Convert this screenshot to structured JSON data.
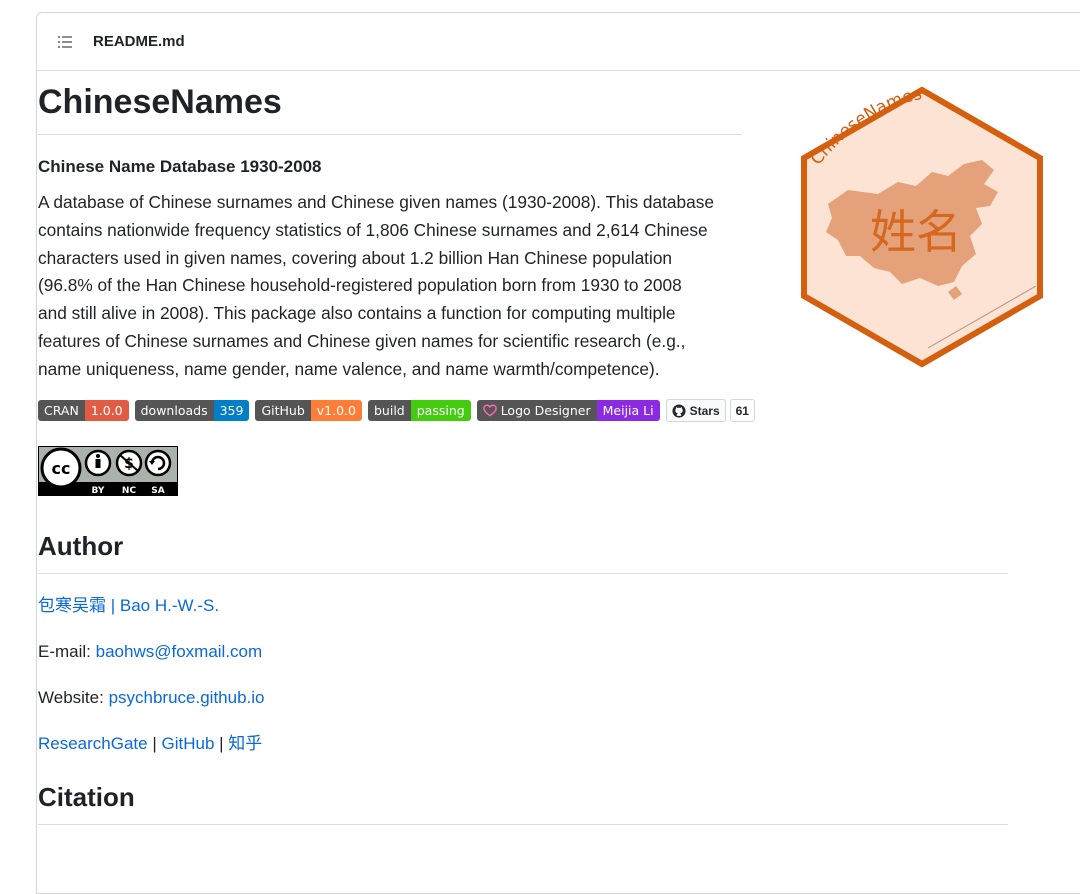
{
  "header": {
    "filename": "README.md",
    "icon": "list-unordered-icon"
  },
  "title": "ChineseNames",
  "subtitle": "Chinese Name Database 1930-2008",
  "description": [
    "A database of Chinese surnames and Chinese given names (1930-2008). This database",
    "contains nationwide frequency statistics of 1,806 Chinese surnames and 2,614 Chinese",
    "characters used in given names, covering about 1.2 billion Han Chinese population",
    "(96.8% of the Han Chinese household-registered population born from 1930 to 2008",
    "and still alive in 2008). This package also contains a function for computing multiple",
    "features of Chinese surnames and Chinese given names for scientific research (e.g.,",
    "name uniqueness, name gender, name valence, and name warmth/competence)."
  ],
  "badges": [
    {
      "left": "CRAN",
      "right": "1.0.0",
      "color": "#e05d44"
    },
    {
      "left": "downloads",
      "right": "359",
      "color": "#007ec6"
    },
    {
      "left": "GitHub",
      "right": "v1.0.0",
      "color": "#fe7d37"
    },
    {
      "left": "build",
      "right": "passing",
      "color": "#4c1"
    },
    {
      "left": "Logo Designer",
      "right": "Meijia Li",
      "color": "#8a2be2",
      "icon": "heart-icon"
    }
  ],
  "github_stars": {
    "label": "Stars",
    "count": "61"
  },
  "license_badge": {
    "labels": [
      "BY",
      "NC",
      "SA"
    ]
  },
  "author": {
    "heading": "Author",
    "name_link": "包寒吴霜 | Bao H.-W.-S.",
    "email_label": "E-mail: ",
    "email": "baohws@foxmail.com",
    "website_label": "Website: ",
    "website": "psychbruce.github.io",
    "links": [
      "ResearchGate",
      "GitHub",
      "知乎"
    ],
    "separator": " | "
  },
  "citation": {
    "heading": "Citation"
  },
  "logo": {
    "arc_text": "ChineseNames",
    "center_text": "姓名",
    "fill": "#fde3d3",
    "border": "#d35f0f",
    "map_color": "#e5a17a"
  }
}
